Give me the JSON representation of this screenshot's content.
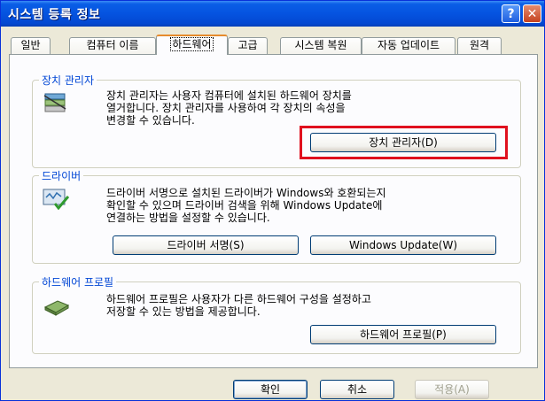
{
  "window": {
    "title": "시스템 등록 정보",
    "help": "?",
    "close": "✕"
  },
  "tabs": [
    {
      "label": "일반"
    },
    {
      "label": "컴퓨터 이름"
    },
    {
      "label": "하드웨어"
    },
    {
      "label": "고급"
    },
    {
      "label": "시스템 복원"
    },
    {
      "label": "자동 업데이트"
    },
    {
      "label": "원격"
    }
  ],
  "groups": {
    "device_manager": {
      "title": "장치 관리자",
      "desc": [
        "장치 관리자는 사용자 컴퓨터에 설치된 하드웨어 장치를",
        "열거합니다. 장치 관리자를 사용하여 각 장치의 속성을",
        "변경할 수 있습니다."
      ],
      "button": "장치 관리자(D)"
    },
    "drivers": {
      "title": "드라이버",
      "desc": [
        "드라이버 서명으로 설치된 드라이버가 Windows와 호환되는지",
        "확인할 수 있으며 드라이버 검색을 위해 Windows Update에",
        "연결하는 방법을 설정할 수 있습니다."
      ],
      "signing_button": "드라이버 서명(S)",
      "update_button": "Windows Update(W)"
    },
    "hw_profiles": {
      "title": "하드웨어 프로필",
      "desc": [
        "하드웨어 프로필은 사용자가 다른 하드웨어 구성을 설정하고",
        "저장할 수 있는 방법을 제공합니다."
      ],
      "button": "하드웨어 프로필(P)"
    }
  },
  "footer": {
    "ok": "확인",
    "cancel": "취소",
    "apply": "적용(A)"
  },
  "colors": {
    "title_blue": "#0553e0",
    "group_title": "#0046d5",
    "highlight": "#e0101e",
    "active_tab_accent": "#e68b2c"
  },
  "icons": [
    "device-manager-icon",
    "driver-signing-icon",
    "hardware-profile-icon",
    "help-icon",
    "close-icon"
  ]
}
